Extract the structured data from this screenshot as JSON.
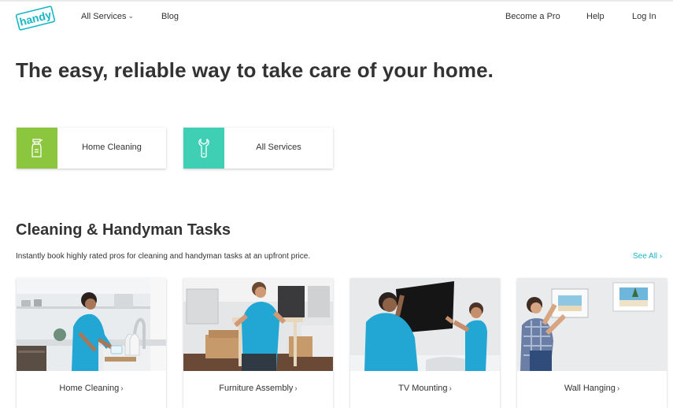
{
  "header": {
    "logo_text": "handy",
    "nav_left": [
      {
        "label": "All Services",
        "has_dropdown": true
      },
      {
        "label": "Blog"
      }
    ],
    "nav_right": [
      {
        "label": "Become a Pro"
      },
      {
        "label": "Help"
      },
      {
        "label": "Log In"
      }
    ]
  },
  "hero": {
    "title": "The easy, reliable way to take care of your home."
  },
  "categories": [
    {
      "label": "Home Cleaning",
      "icon": "spray-bottle-icon",
      "color": "#8cc63f"
    },
    {
      "label": "All Services",
      "icon": "wrench-icon",
      "color": "#3fcfb4"
    }
  ],
  "tasks_section": {
    "title": "Cleaning & Handyman Tasks",
    "subtitle": "Instantly book highly rated pros for cleaning and handyman tasks at an upfront price.",
    "see_all": "See All",
    "tasks": [
      {
        "label": "Home Cleaning"
      },
      {
        "label": "Furniture Assembly"
      },
      {
        "label": "TV Mounting"
      },
      {
        "label": "Wall Hanging"
      }
    ]
  },
  "colors": {
    "brand": "#15b7c6",
    "text": "#333333"
  }
}
